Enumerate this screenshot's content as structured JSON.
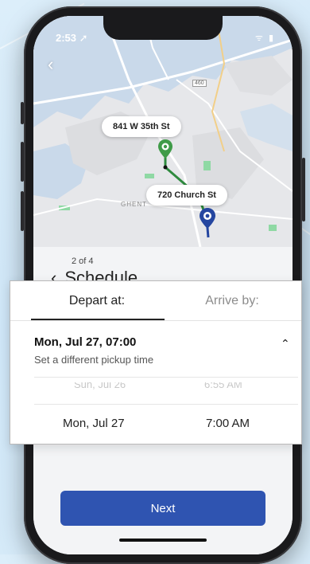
{
  "status": {
    "time": "2:53 ➚",
    "icons": "ᯤ ▮"
  },
  "map": {
    "pickup_address": "841 W 35th St",
    "dropoff_address": "720 Church St",
    "highway_badge": "460",
    "area_label": "GHENT",
    "colors": {
      "route": "#2e8a3e",
      "pickup_pin": "#3f9b48",
      "dropoff_pin": "#2546a0"
    }
  },
  "schedule": {
    "step": "2 of 4",
    "title": "Schedule",
    "next_label": "Next"
  },
  "picker": {
    "tabs": [
      {
        "label": "Depart at:",
        "active": true
      },
      {
        "label": "Arrive by:",
        "active": false
      }
    ],
    "selected": "Mon, Jul 27, 07:00",
    "helper": "Set a different pickup time",
    "wheel_prev_date": "Sun, Jul 26",
    "wheel_prev_time": "6:55 AM",
    "wheel_date": "Mon, Jul 27",
    "wheel_time": "7:00 AM"
  },
  "icons": {
    "back": "chevron-left-icon",
    "collapse": "chevron-up-icon",
    "pickup": "location-pin-icon",
    "dropoff": "location-pin-icon"
  },
  "colors": {
    "primary": "#2f54b1"
  }
}
